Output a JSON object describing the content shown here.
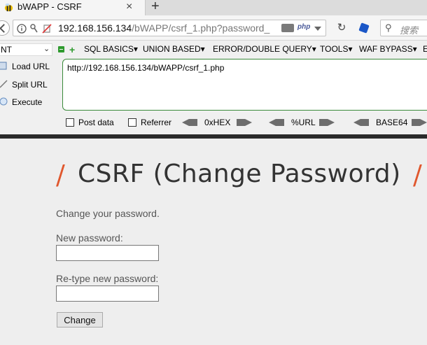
{
  "browser": {
    "tab_title": "bWAPP - CSRF",
    "tab_close": "×",
    "new_tab": "+",
    "address": {
      "host": "192.168.156.134",
      "path": "/bWAPP/csrf_1.php?password_"
    },
    "php_label": "php",
    "reload": "↻",
    "search_glyph": "🔍",
    "search_placeholder": "搜索"
  },
  "hackbar": {
    "select_value": "NT",
    "select_chevron": "⌄",
    "menus": [
      "SQL BASICS▾",
      "UNION BASED▾",
      "ERROR/DOUBLE QUERY▾",
      "TOOLS▾",
      "WAF BYPASS▾",
      "E"
    ],
    "actions": [
      "Load URL",
      "Split URL",
      "Execute"
    ],
    "url_value": "http://192.168.156.134/bWAPP/csrf_1.php",
    "options": {
      "post_data": "Post data",
      "referrer": "Referrer",
      "hex": "0xHEX",
      "url": "%URL",
      "base64": "BASE64"
    }
  },
  "page": {
    "slash": "/",
    "title": "CSRF (Change Password)",
    "intro": "Change your password.",
    "new_password_label": "New password:",
    "retype_label": "Re-type new password:",
    "change_button": "Change"
  },
  "colors": {
    "accent": "#e0572d",
    "hackbar_green": "#2e9a2e"
  }
}
